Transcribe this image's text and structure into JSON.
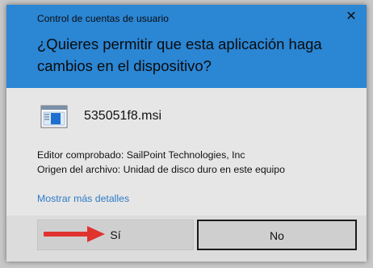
{
  "window": {
    "title": "Control de cuentas de usuario",
    "close_glyph": "✕"
  },
  "prompt": {
    "question": "¿Quieres permitir que esta aplicación haga cambios en el dispositivo?"
  },
  "app": {
    "icon": "installer-icon",
    "name": "535051f8.msi"
  },
  "details": {
    "publisher_line": "Editor comprobado: SailPoint Technologies, Inc",
    "origin_line": "Origen del archivo: Unidad de disco duro en este equipo",
    "more_details_link": "Mostrar más detalles"
  },
  "buttons": {
    "yes_label": "Sí",
    "no_label": "No"
  },
  "colors": {
    "header_bg": "#2b86d4",
    "link": "#2f7bc6",
    "annotation_arrow": "#e0332e"
  }
}
